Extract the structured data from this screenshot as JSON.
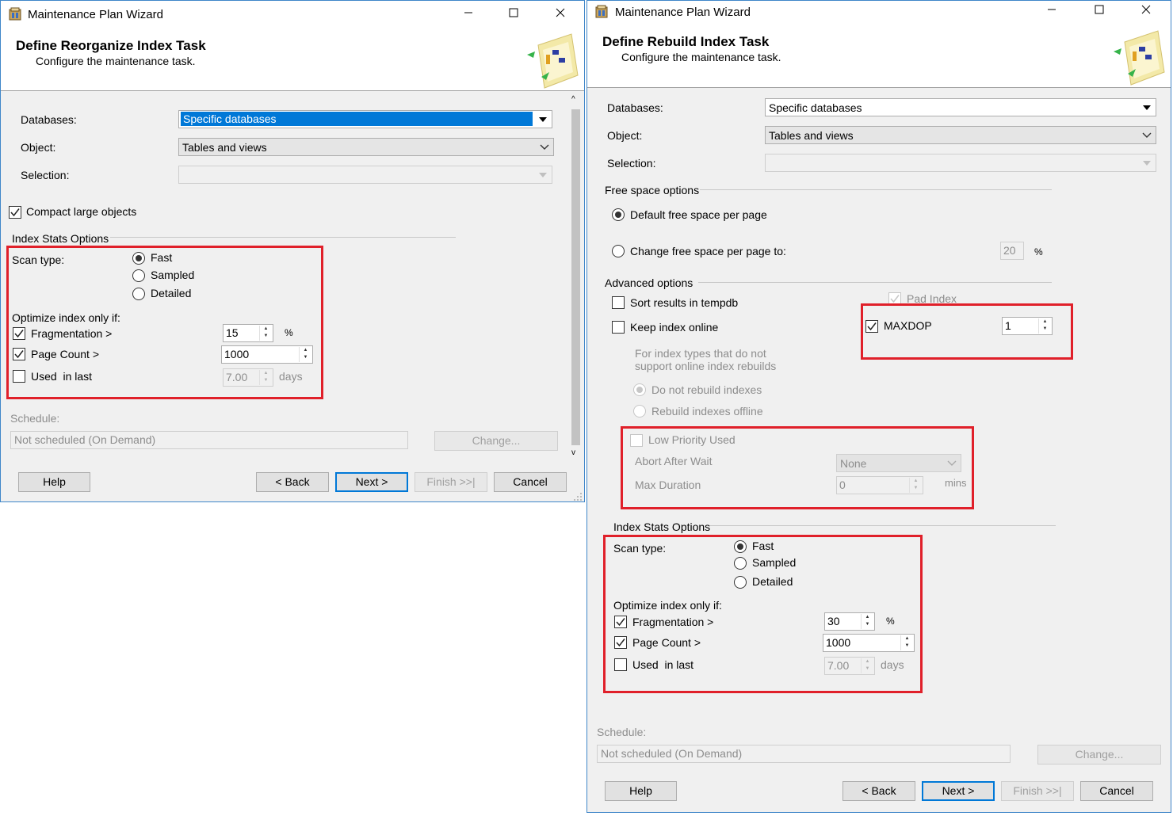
{
  "left_window": {
    "title": "Maintenance Plan Wizard",
    "header_title": "Define Reorganize Index Task",
    "header_subtitle": "Configure the maintenance task.",
    "databases_label": "Databases:",
    "databases_value": "Specific databases",
    "object_label": "Object:",
    "object_value": "Tables and views",
    "selection_label": "Selection:",
    "compact_label": "Compact large objects",
    "compact_checked": true,
    "index_stats_label": "Index Stats Options",
    "scan_type_label": "Scan type:",
    "scan_fast": "Fast",
    "scan_sampled": "Sampled",
    "scan_detailed": "Detailed",
    "optimize_label": "Optimize index only if:",
    "fragmentation_label": "Fragmentation >",
    "fragmentation_value": "15",
    "fragmentation_unit": "%",
    "page_count_label": "Page Count >",
    "page_count_value": "1000",
    "used_label": "Used  in last",
    "used_value": "7.00",
    "used_unit": "days",
    "schedule_label": "Schedule:",
    "schedule_value": "Not scheduled (On Demand)",
    "change_button": "Change...",
    "help_button": "Help",
    "back_button": "< Back",
    "next_button": "Next >",
    "finish_button": "Finish >>|",
    "cancel_button": "Cancel"
  },
  "right_window": {
    "title": "Maintenance Plan Wizard",
    "header_title": "Define Rebuild Index Task",
    "header_subtitle": "Configure the maintenance task.",
    "databases_label": "Databases:",
    "databases_value": "Specific databases",
    "object_label": "Object:",
    "object_value": "Tables and views",
    "selection_label": "Selection:",
    "free_space_label": "Free space options",
    "default_free_space": "Default free space per page",
    "change_free_space": "Change free space per page to:",
    "free_space_value": "20",
    "free_space_unit": "%",
    "advanced_label": "Advanced options",
    "sort_results": "Sort results in tempdb",
    "pad_index": "Pad Index",
    "keep_online": "Keep index online",
    "maxdop_label": "MAXDOP",
    "maxdop_value": "1",
    "online_note_line1": "For index types that do not",
    "online_note_line2": "support online index rebuilds",
    "do_not_rebuild": "Do not rebuild indexes",
    "rebuild_offline": "Rebuild indexes offline",
    "low_priority": "Low Priority Used",
    "abort_after_wait": "Abort After Wait",
    "abort_value": "None",
    "max_duration": "Max Duration",
    "max_duration_value": "0",
    "max_duration_unit": "mins",
    "index_stats_label": "Index Stats Options",
    "scan_type_label": "Scan type:",
    "scan_fast": "Fast",
    "scan_sampled": "Sampled",
    "scan_detailed": "Detailed",
    "optimize_label": "Optimize index only if:",
    "fragmentation_label": "Fragmentation >",
    "fragmentation_value": "30",
    "fragmentation_unit": "%",
    "page_count_label": "Page Count >",
    "page_count_value": "1000",
    "used_label": "Used  in last",
    "used_value": "7.00",
    "used_unit": "days",
    "schedule_label": "Schedule:",
    "schedule_value": "Not scheduled (On Demand)",
    "change_button": "Change...",
    "help_button": "Help",
    "back_button": "< Back",
    "next_button": "Next >",
    "finish_button": "Finish >>|",
    "cancel_button": "Cancel"
  },
  "colors": {
    "highlight_box": "#e0202a",
    "selection_blue": "#0078d7",
    "dialog_bg": "#f0f0f0"
  }
}
